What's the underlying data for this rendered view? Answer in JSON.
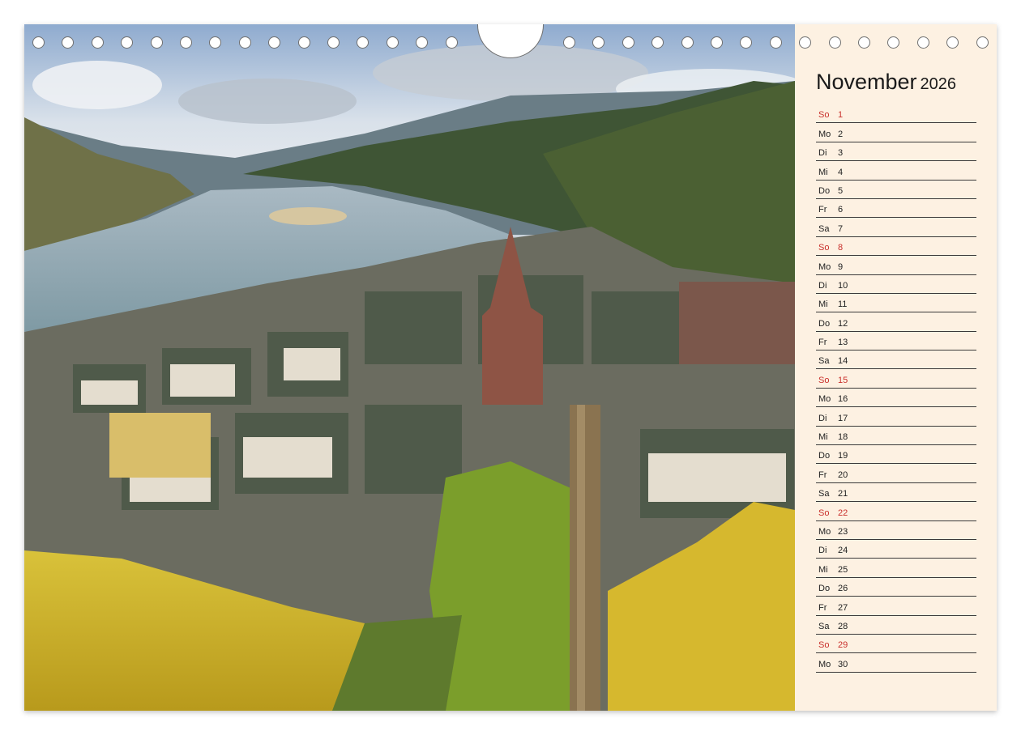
{
  "calendar": {
    "month": "November",
    "year": "2026",
    "days": [
      {
        "weekday": "So",
        "day": "1",
        "sunday": true
      },
      {
        "weekday": "Mo",
        "day": "2"
      },
      {
        "weekday": "Di",
        "day": "3"
      },
      {
        "weekday": "Mi",
        "day": "4"
      },
      {
        "weekday": "Do",
        "day": "5"
      },
      {
        "weekday": "Fr",
        "day": "6"
      },
      {
        "weekday": "Sa",
        "day": "7"
      },
      {
        "weekday": "So",
        "day": "8",
        "sunday": true
      },
      {
        "weekday": "Mo",
        "day": "9"
      },
      {
        "weekday": "Di",
        "day": "10"
      },
      {
        "weekday": "Mi",
        "day": "11"
      },
      {
        "weekday": "Do",
        "day": "12"
      },
      {
        "weekday": "Fr",
        "day": "13"
      },
      {
        "weekday": "Sa",
        "day": "14"
      },
      {
        "weekday": "So",
        "day": "15",
        "sunday": true
      },
      {
        "weekday": "Mo",
        "day": "16"
      },
      {
        "weekday": "Di",
        "day": "17"
      },
      {
        "weekday": "Mi",
        "day": "18"
      },
      {
        "weekday": "Do",
        "day": "19"
      },
      {
        "weekday": "Fr",
        "day": "20"
      },
      {
        "weekday": "Sa",
        "day": "21"
      },
      {
        "weekday": "So",
        "day": "22",
        "sunday": true
      },
      {
        "weekday": "Mo",
        "day": "23"
      },
      {
        "weekday": "Di",
        "day": "24"
      },
      {
        "weekday": "Mi",
        "day": "25"
      },
      {
        "weekday": "Do",
        "day": "26"
      },
      {
        "weekday": "Fr",
        "day": "27"
      },
      {
        "weekday": "Sa",
        "day": "28"
      },
      {
        "weekday": "So",
        "day": "29",
        "sunday": true
      },
      {
        "weekday": "Mo",
        "day": "30"
      }
    ]
  },
  "colors": {
    "sunday": "#c9302c",
    "sidebar_bg": "#fdf1e2",
    "rule": "#3a3a3a"
  }
}
